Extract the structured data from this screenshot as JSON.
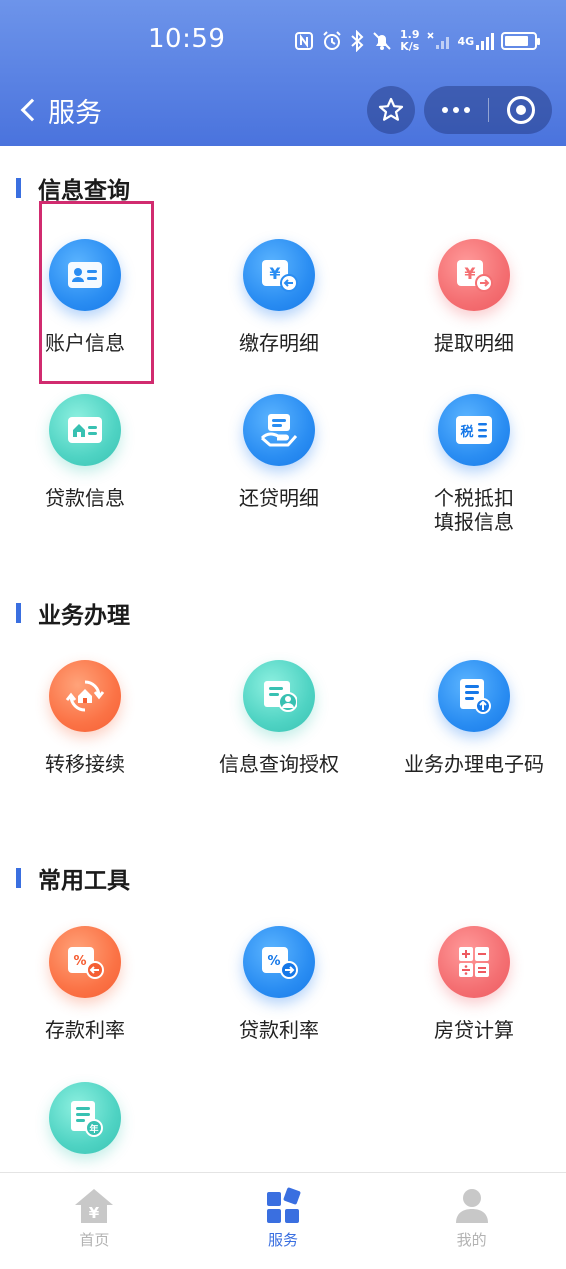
{
  "status_bar": {
    "time": "10:59",
    "net_speed_value": "1.9",
    "net_speed_unit": "K/s",
    "network_type": "4G",
    "battery_level": 0.82
  },
  "nav": {
    "title": "服务",
    "icons": [
      "chevron-left-icon",
      "star-icon",
      "more-dots-icon",
      "target-icon"
    ]
  },
  "sections": [
    {
      "title": "信息查询",
      "items": [
        {
          "label": "账户信息",
          "icon": "id-card-icon"
        },
        {
          "label": "缴存明细",
          "icon": "yuan-deposit-icon"
        },
        {
          "label": "提取明细",
          "icon": "yuan-withdraw-icon"
        },
        {
          "label": "贷款信息",
          "icon": "house-card-icon"
        },
        {
          "label": "还贷明细",
          "icon": "hand-repay-icon"
        },
        {
          "label": "个税抵扣填报信息",
          "icon": "tax-icon",
          "badge": "税"
        }
      ]
    },
    {
      "title": "业务办理",
      "items": [
        {
          "label": "转移接续",
          "icon": "transfer-house-icon"
        },
        {
          "label": "信息查询授权",
          "icon": "authorize-user-icon"
        },
        {
          "label": "业务办理电子码",
          "icon": "document-upload-icon"
        }
      ]
    },
    {
      "title": "常用工具",
      "items": [
        {
          "label": "存款利率",
          "icon": "percent-in-icon"
        },
        {
          "label": "贷款利率",
          "icon": "percent-out-icon"
        },
        {
          "label": "房贷计算",
          "icon": "calculator-icon"
        },
        {
          "label": "",
          "icon": "year-document-icon",
          "badge": "年"
        }
      ]
    }
  ],
  "tabbar": {
    "tabs": [
      {
        "label": "首页",
        "icon": "home-yuan-icon",
        "active": false
      },
      {
        "label": "服务",
        "icon": "grid-icon",
        "active": true
      },
      {
        "label": "我的",
        "icon": "user-icon",
        "active": false
      }
    ]
  },
  "colors": {
    "header_top": "#6d94ea",
    "header_bottom": "#4a73dd",
    "accent": "#3a6fe0",
    "highlight_box": "#d12b6f"
  }
}
